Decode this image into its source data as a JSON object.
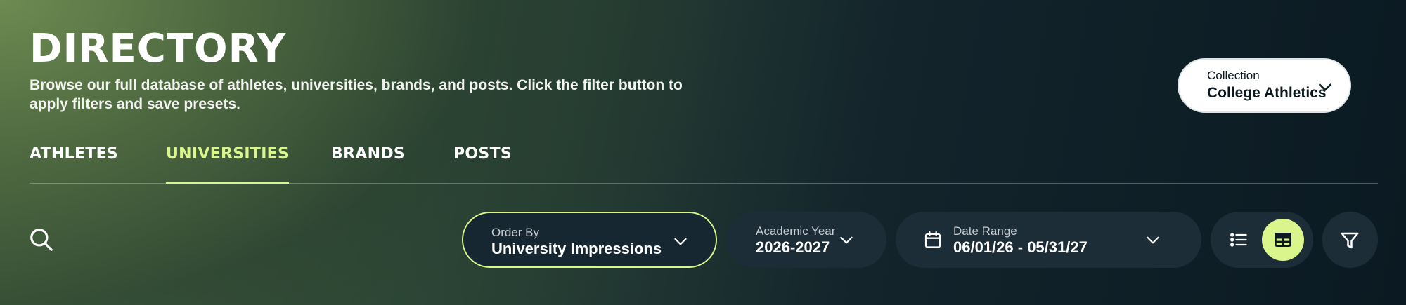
{
  "page": {
    "title": "DIRECTORY",
    "subtitle": "Browse our full database of athletes, universities, brands, and posts. Click the filter button to apply filters and save presets."
  },
  "collection": {
    "label": "Collection",
    "value": "College Athletics",
    "icon": "chevron-down-icon"
  },
  "tabs": [
    {
      "label": "ATHLETES",
      "active": false
    },
    {
      "label": "UNIVERSITIES",
      "active": true
    },
    {
      "label": "BRANDS",
      "active": false
    },
    {
      "label": "POSTS",
      "active": false
    }
  ],
  "search": {
    "icon": "search-icon"
  },
  "order_by": {
    "label": "Order By",
    "value": "University Impressions",
    "icon": "chevron-down-icon"
  },
  "academic_year": {
    "label": "Academic Year",
    "value": "2026-2027",
    "icon": "chevron-down-icon"
  },
  "date_range": {
    "label": "Date Range",
    "value": "06/01/26 - 05/31/27",
    "icon": "calendar-icon"
  },
  "view_toggle": {
    "options": [
      "list-view-icon",
      "table-view-icon"
    ],
    "selected": "table-view-icon"
  },
  "filter": {
    "icon": "filter-icon"
  },
  "colors": {
    "accent": "#d9f58c",
    "pill_bg": "#1d2d38",
    "background_dark": "#0b1a22",
    "background_green": "#6e8c52"
  }
}
